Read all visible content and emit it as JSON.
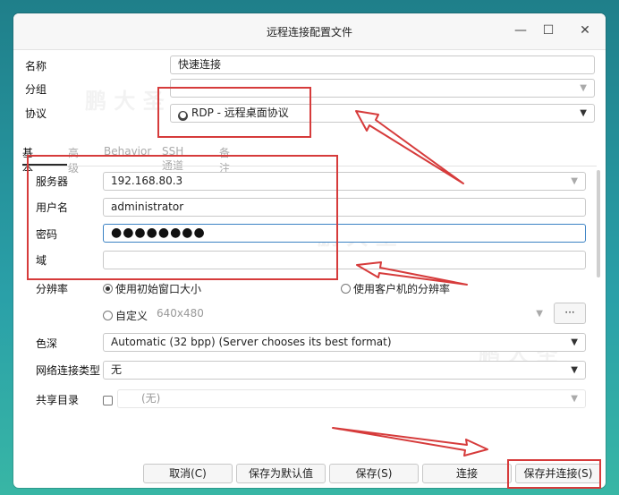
{
  "window": {
    "title": "远程连接配置文件",
    "minimize_glyph": "—",
    "maximize_glyph": "☐",
    "close_glyph": "✕"
  },
  "top": {
    "name_label": "名称",
    "name_value": "快速连接",
    "group_label": "分组",
    "group_value": "",
    "protocol_label": "协议",
    "protocol_value": "RDP - 远程桌面协议",
    "protocol_icon": "rdp-icon"
  },
  "tabs": [
    {
      "label": "基本"
    },
    {
      "label": "高级"
    },
    {
      "label": "Behavior"
    },
    {
      "label": "SSH 通道"
    },
    {
      "label": "备注"
    }
  ],
  "basic": {
    "server_label": "服务器",
    "server_value": "192.168.80.3",
    "user_label": "用户名",
    "user_value": "administrator",
    "password_label": "密码",
    "password_value": "●●●●●●●●",
    "domain_label": "域",
    "domain_value": "",
    "resolution_label": "分辨率",
    "res_option_initial": "使用初始窗口大小",
    "res_option_client": "使用客户机的分辨率",
    "res_option_custom": "自定义",
    "res_custom_value": "640x480",
    "res_more_button": "···",
    "depth_label": "色深",
    "depth_value": "Automatic (32 bpp) (Server chooses its best format)",
    "network_label": "网络连接类型",
    "network_value": "无",
    "share_label": "共享目录",
    "share_value": "(无)"
  },
  "buttons": {
    "cancel": "取消(C)",
    "save_default": "保存为默认值",
    "save": "保存(S)",
    "connect": "连接",
    "save_connect": "保存并连接(S)"
  },
  "watermark": "鹏 大 圣",
  "colors": {
    "annotation_red": "#d63b3b",
    "focus_blue": "#3b82c4"
  }
}
